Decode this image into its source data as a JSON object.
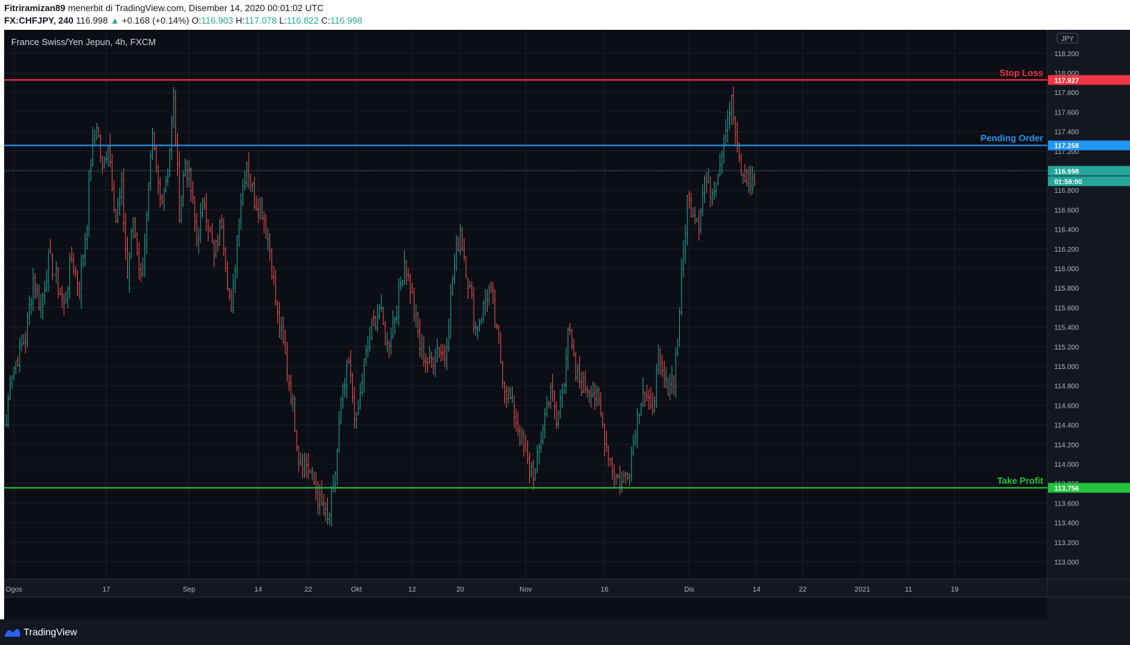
{
  "header": {
    "author": "Fitriramizan89",
    "published_text": "menerbit di TradingView.com, Disember 14, 2020 00:01:02 UTC",
    "symbol": "FX:CHFJPY, 240",
    "last_price": "116.998",
    "change": "+0.168 (+0.14%)",
    "open_label": "O:",
    "open": "116.903",
    "high_label": "H:",
    "high": "117.078",
    "low_label": "L:",
    "low": "116.822",
    "close_label": "C:",
    "close": "116.998"
  },
  "chart_title": "France Swiss/Yen Jepun, 4h, FXCM",
  "currency_badge": "JPY",
  "footer": {
    "brand": "TradingView"
  },
  "colors": {
    "background": "#0c0e15",
    "grid": "#1a1e29",
    "up": "#26a69a",
    "down": "#ef5350",
    "stop_loss": "#f23645",
    "pending": "#2196f3",
    "take_profit": "#22c33b",
    "axis_text": "#b2b5be"
  },
  "chart_data": {
    "type": "ohlc",
    "title": "France Swiss/Yen Jepun, 4h, FXCM",
    "ylim": [
      112.85,
      118.45
    ],
    "y_ticks": [
      "113.000",
      "113.200",
      "113.400",
      "113.600",
      "113.800",
      "114.000",
      "114.200",
      "114.400",
      "114.600",
      "114.800",
      "115.000",
      "115.200",
      "115.400",
      "115.600",
      "115.800",
      "116.000",
      "116.200",
      "116.400",
      "116.600",
      "116.800",
      "117.000",
      "117.200",
      "117.400",
      "117.600",
      "117.800",
      "118.000",
      "118.200"
    ],
    "x_ticks": [
      {
        "label": "Ogos",
        "bar": 4
      },
      {
        "label": "17",
        "bar": 52
      },
      {
        "label": "Sep",
        "bar": 95
      },
      {
        "label": "14",
        "bar": 131
      },
      {
        "label": "22",
        "bar": 157
      },
      {
        "label": "Okt",
        "bar": 182
      },
      {
        "label": "12",
        "bar": 211
      },
      {
        "label": "20",
        "bar": 236
      },
      {
        "label": "Nov",
        "bar": 270
      },
      {
        "label": "16",
        "bar": 311
      },
      {
        "label": "Dis",
        "bar": 355
      },
      {
        "label": "14",
        "bar": 390
      },
      {
        "label": "22",
        "bar": 414
      },
      {
        "label": "2021",
        "bar": 445
      },
      {
        "label": "11",
        "bar": 469
      },
      {
        "label": "19",
        "bar": 493
      }
    ],
    "levels": [
      {
        "name": "Stop Loss",
        "value": 117.927,
        "label": "117.927",
        "color": "#f23645"
      },
      {
        "name": "Pending Order",
        "value": 117.258,
        "label": "117.258",
        "color": "#2196f3"
      },
      {
        "name": "Take Profit",
        "value": 113.756,
        "label": "113.756",
        "color": "#22c33b"
      }
    ],
    "current_price": {
      "value": 116.998,
      "label": "116.998",
      "countdown": "01:59:00"
    },
    "bars_count": 390,
    "anchors": [
      [
        0,
        114.4
      ],
      [
        2,
        114.9
      ],
      [
        6,
        115.1
      ],
      [
        10,
        115.3
      ],
      [
        14,
        115.9
      ],
      [
        18,
        115.6
      ],
      [
        22,
        116.1
      ],
      [
        26,
        115.9
      ],
      [
        30,
        115.6
      ],
      [
        34,
        116.1
      ],
      [
        38,
        115.8
      ],
      [
        42,
        116.5
      ],
      [
        44,
        117.1
      ],
      [
        47,
        117.5
      ],
      [
        50,
        117.0
      ],
      [
        53,
        117.3
      ],
      [
        57,
        116.5
      ],
      [
        60,
        116.8
      ],
      [
        63,
        115.9
      ],
      [
        66,
        116.5
      ],
      [
        70,
        115.9
      ],
      [
        73,
        116.5
      ],
      [
        76,
        117.3
      ],
      [
        80,
        116.7
      ],
      [
        84,
        117.0
      ],
      [
        87,
        117.7
      ],
      [
        90,
        116.6
      ],
      [
        93,
        117.1
      ],
      [
        96,
        116.8
      ],
      [
        99,
        116.3
      ],
      [
        103,
        116.7
      ],
      [
        108,
        116.1
      ],
      [
        112,
        116.5
      ],
      [
        117,
        115.5
      ],
      [
        121,
        116.6
      ],
      [
        125,
        117.1
      ],
      [
        129,
        116.7
      ],
      [
        133,
        116.6
      ],
      [
        137,
        116.2
      ],
      [
        141,
        115.5
      ],
      [
        145,
        115.1
      ],
      [
        149,
        114.6
      ],
      [
        152,
        114.1
      ],
      [
        156,
        114.0
      ],
      [
        160,
        113.8
      ],
      [
        163,
        113.6
      ],
      [
        167,
        113.4
      ],
      [
        170,
        113.7
      ],
      [
        174,
        114.6
      ],
      [
        178,
        115.0
      ],
      [
        182,
        114.4
      ],
      [
        186,
        115.0
      ],
      [
        190,
        115.4
      ],
      [
        194,
        115.6
      ],
      [
        198,
        115.2
      ],
      [
        203,
        115.6
      ],
      [
        207,
        116.1
      ],
      [
        211,
        115.7
      ],
      [
        215,
        115.2
      ],
      [
        220,
        115.0
      ],
      [
        224,
        115.2
      ],
      [
        228,
        115.1
      ],
      [
        232,
        115.9
      ],
      [
        236,
        116.4
      ],
      [
        240,
        115.9
      ],
      [
        244,
        115.4
      ],
      [
        248,
        115.6
      ],
      [
        251,
        115.8
      ],
      [
        255,
        115.3
      ],
      [
        259,
        114.8
      ],
      [
        263,
        114.6
      ],
      [
        267,
        114.3
      ],
      [
        271,
        114.0
      ],
      [
        275,
        113.9
      ],
      [
        279,
        114.4
      ],
      [
        283,
        114.8
      ],
      [
        286,
        114.4
      ],
      [
        290,
        114.9
      ],
      [
        292,
        115.4
      ],
      [
        296,
        114.9
      ],
      [
        300,
        114.8
      ],
      [
        304,
        114.8
      ],
      [
        308,
        114.6
      ],
      [
        312,
        114.2
      ],
      [
        316,
        113.9
      ],
      [
        320,
        113.8
      ],
      [
        324,
        114.0
      ],
      [
        328,
        114.5
      ],
      [
        331,
        114.8
      ],
      [
        335,
        114.5
      ],
      [
        339,
        115.0
      ],
      [
        343,
        114.8
      ],
      [
        347,
        114.9
      ],
      [
        349,
        115.3
      ],
      [
        351,
        115.9
      ],
      [
        354,
        116.7
      ],
      [
        357,
        116.6
      ],
      [
        360,
        116.5
      ],
      [
        363,
        116.9
      ],
      [
        367,
        116.8
      ],
      [
        371,
        117.1
      ],
      [
        374,
        117.5
      ],
      [
        377,
        117.7
      ],
      [
        380,
        117.2
      ],
      [
        383,
        116.9
      ],
      [
        386,
        116.9
      ]
    ]
  }
}
